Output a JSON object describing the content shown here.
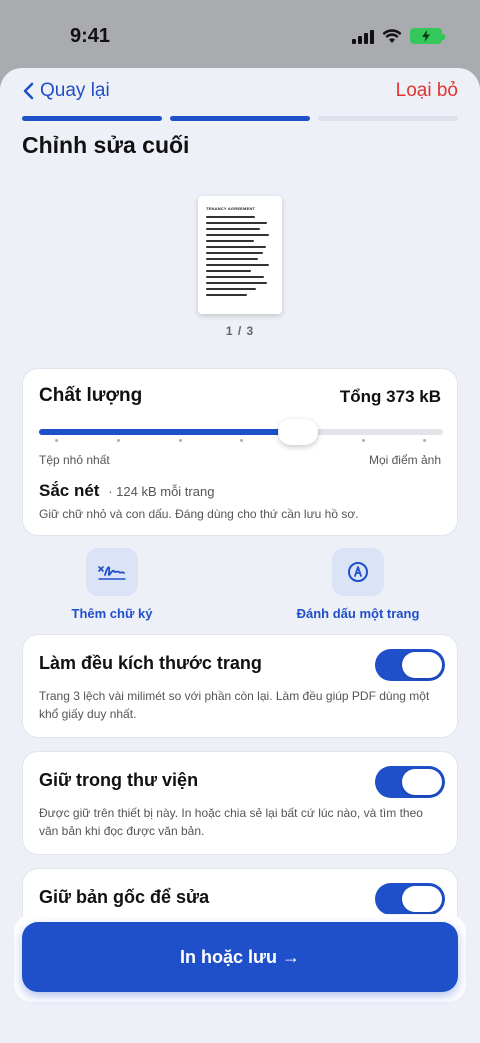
{
  "status_bar": {
    "time": "9:41",
    "battery_color": "#34c759"
  },
  "nav": {
    "back_label": "Quay lại",
    "discard_label": "Loại bỏ"
  },
  "steps": {
    "total": 3,
    "completed": 2,
    "active_color": "#1f4fc9",
    "inactive_color": "#dde1ec"
  },
  "page_title": "Chỉnh sửa cuối",
  "preview": {
    "document_title": "TENANCY AGREEMENT",
    "page_indicator": "1 / 3"
  },
  "quality": {
    "title": "Chất lượng",
    "total": "Tổng 373 kB",
    "slider_fraction": 0.64,
    "min_label": "Tệp nhỏ nhất",
    "max_label": "Mọi điểm ảnh",
    "level_name": "Sắc nét",
    "level_size": "· 124 kB mỗi trang",
    "description": "Giữ chữ nhỏ và con dấu. Đáng dùng cho thứ cần lưu hồ sơ."
  },
  "actions": [
    {
      "icon": "signature-icon",
      "label": "Thêm chữ ký"
    },
    {
      "icon": "markup-pen-icon",
      "label": "Đánh dấu một trang"
    }
  ],
  "options": [
    {
      "title": "Làm đều kích thước trang",
      "description": "Trang 3 lệch vài milimét so với phần còn lại. Làm đều giúp PDF dùng một khổ giấy duy nhất.",
      "enabled": true
    },
    {
      "title": "Giữ trong thư viện",
      "description": "Được giữ trên thiết bị này. In hoặc chia sẻ lại bất cứ lúc nào, và tìm theo văn bản khi đọc được văn bản.",
      "enabled": true
    },
    {
      "title": "Giữ bản gốc để sửa",
      "description": "",
      "enabled": true
    }
  ],
  "primary_button": {
    "label": "In hoặc lưu →",
    "color": "#1f4fc9"
  },
  "colors": {
    "accent": "#1f4fc9",
    "danger": "#e3342f",
    "sheet_bg": "#eef0f8"
  }
}
